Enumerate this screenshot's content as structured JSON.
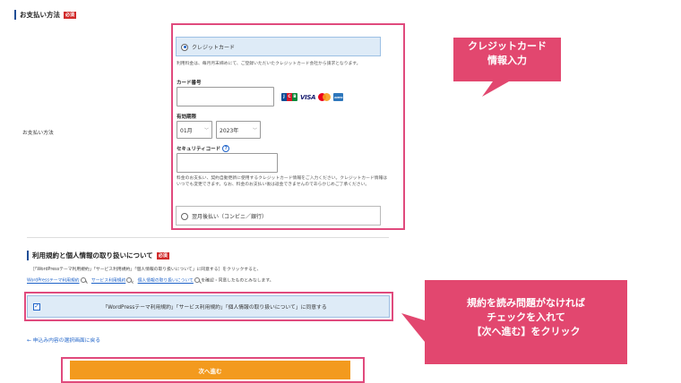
{
  "payment": {
    "section_title": "お支払い方法",
    "required_badge": "必須",
    "row_label": "お支払い方法",
    "credit_label": "クレジットカード",
    "credit_note": "利用料金は、毎月月末締めにて、ご登録いただいたクレジットカード会社から請求となります。",
    "card_number_label": "カード番号",
    "card_number_value": "",
    "card_brands": {
      "jcb": "JCB",
      "visa": "VISA",
      "mastercard": "mastercard",
      "amex": "AMEX",
      "jcb_colors": [
        "#0e4c96",
        "#d7182a",
        "#0a8a3a"
      ],
      "mc_colors": [
        "#eb001b",
        "#f79e1b"
      ]
    },
    "expiry_label": "有効期限",
    "expiry_month": "01月",
    "expiry_year": "2023年",
    "security_label": "セキュリティコード",
    "help_symbol": "?",
    "security_value": "",
    "security_note": "料金のお支払い、契約自動更新に使用するクレジットカード情報をご入力ください。クレジットカード情報はいつでも変更できます。なお、料金のお支払い後は返金できませんのであらかじめご了承ください。",
    "convenience_label": "翌月後払い（コンビニ／銀行）"
  },
  "terms": {
    "section_title": "利用規約と個人情報の取り扱いについて",
    "required_badge": "必須",
    "instruction": "［「WordPressテーマ利用規約」「サービス利用規約」「個人情報の取り扱いについて」に同意する］をクリックすると、",
    "link_wp": "WordPressテーマ利用規約",
    "link_service": "サービス利用規約",
    "link_privacy": "個人情報の取り扱いについて",
    "suffix": "を確認・同意したものとみなします。",
    "sep": "、",
    "agree_label": "「WordPressテーマ利用規約」「サービス利用規約」「個人情報の取り扱いについて」に同意する",
    "agree_checked": true,
    "check_glyph": "✓"
  },
  "nav": {
    "back_link": "← 申込み内容の選択画面に戻る",
    "next_button": "次へ進む"
  },
  "callouts": {
    "card_line1": "クレジットカード",
    "card_line2": "情報入力",
    "terms_line1": "規約を読み問題がなければ",
    "terms_line2": "チェックを入れて",
    "terms_line3": "【次へ進む】をクリック",
    "color": "#e2476f"
  },
  "colors": {
    "accent_blue": "#1f63c9",
    "outline_pink": "#e04a7d",
    "next_orange": "#f39a1e",
    "required_red": "#d12b2b"
  }
}
